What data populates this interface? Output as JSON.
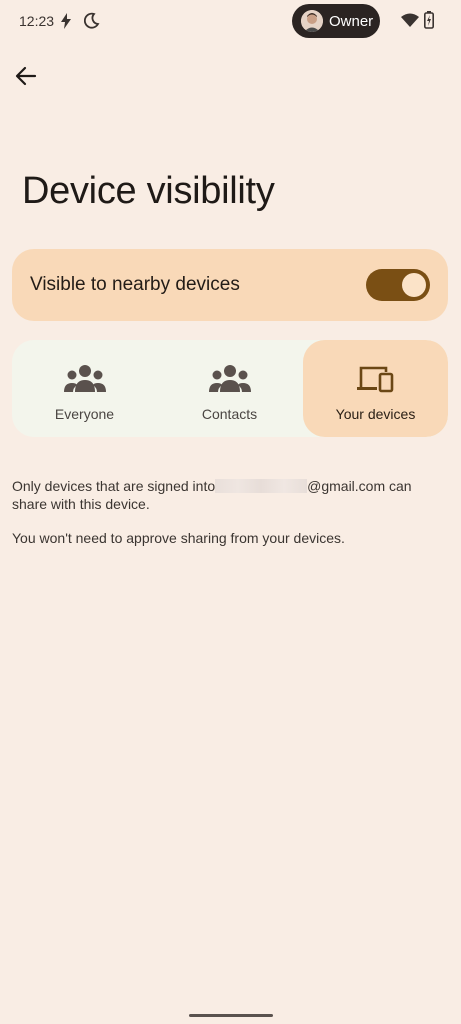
{
  "status_bar": {
    "time": "12:23",
    "icons": [
      "bolt-icon",
      "moon-icon",
      "wifi-icon",
      "battery-charging-icon"
    ],
    "owner_label": "Owner"
  },
  "header": {
    "back_icon": "arrow-back-icon",
    "title": "Device visibility"
  },
  "visibility_toggle": {
    "label": "Visible to nearby devices",
    "on": true
  },
  "segments": {
    "options": [
      {
        "label": "Everyone",
        "icon": "group-icon",
        "selected": false
      },
      {
        "label": "Contacts",
        "icon": "group-icon",
        "selected": false
      },
      {
        "label": "Your devices",
        "icon": "devices-icon",
        "selected": true
      }
    ]
  },
  "description": {
    "line1_prefix": "Only devices that are signed into",
    "line1_suffix": "@gmail.com can",
    "line2": "share with this device.",
    "note": "You won't need to approve sharing from your devices."
  },
  "colors": {
    "background": "#f9ede4",
    "card_accent": "#f9d9b8",
    "switch_track": "#7a4f14",
    "segment_bg": "#f3f5ec"
  }
}
